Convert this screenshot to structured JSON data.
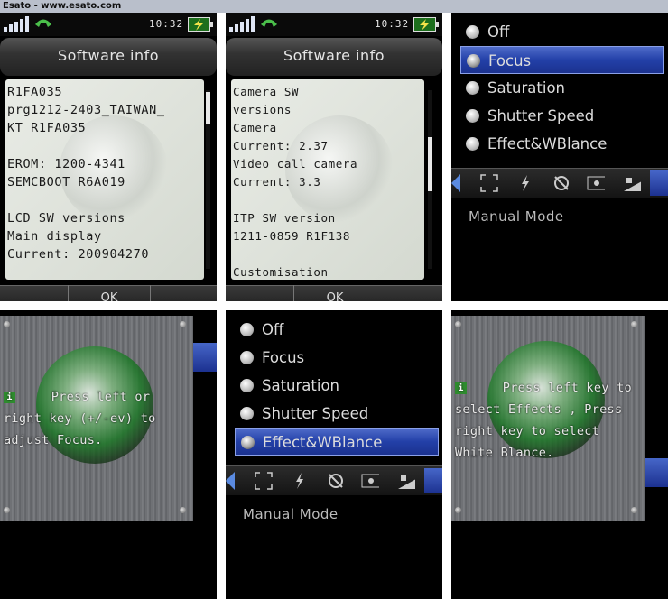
{
  "site": {
    "header": "Esato - www.esato.com"
  },
  "status": {
    "time": "10:32"
  },
  "software_info": {
    "title": "Software info",
    "ok_label": "OK",
    "panel1_lines": [
      "R1FA035",
      "prg1212-2403_TAIWAN_",
      "KT R1FA035",
      "",
      "EROM: 1200-4341",
      "SEMCBOOT R6A019",
      "",
      "LCD SW versions",
      "Main display",
      "Current: 200904270"
    ],
    "panel2_lines": [
      "Camera SW",
      "versions",
      "Camera",
      "Current: 2.37",
      "Video call camera",
      "Current: 3.3",
      "",
      "ITP SW version",
      "1211-0859 R1F138",
      "",
      "Customisation"
    ]
  },
  "camera_menu": {
    "items": [
      "Off",
      "Focus",
      "Saturation",
      "Shutter Speed",
      "Effect&WBlance"
    ],
    "mode_label": "Manual Mode",
    "toolbar_icons": [
      "focus-frame-icon",
      "flash-icon",
      "self-timer-off-icon",
      "metering-spot-icon",
      "exposure-icon",
      "mode-button-icon"
    ]
  },
  "hints": {
    "focus_hint": [
      "Press left or",
      "right key (+/-ev) to",
      "adjust Focus."
    ],
    "effects_hint": [
      "Press left key to",
      "select Effects , Press",
      "right key to select",
      "White Blance."
    ]
  },
  "colors": {
    "accent": "#2340a8",
    "logo_green": "#2e8b2e"
  }
}
